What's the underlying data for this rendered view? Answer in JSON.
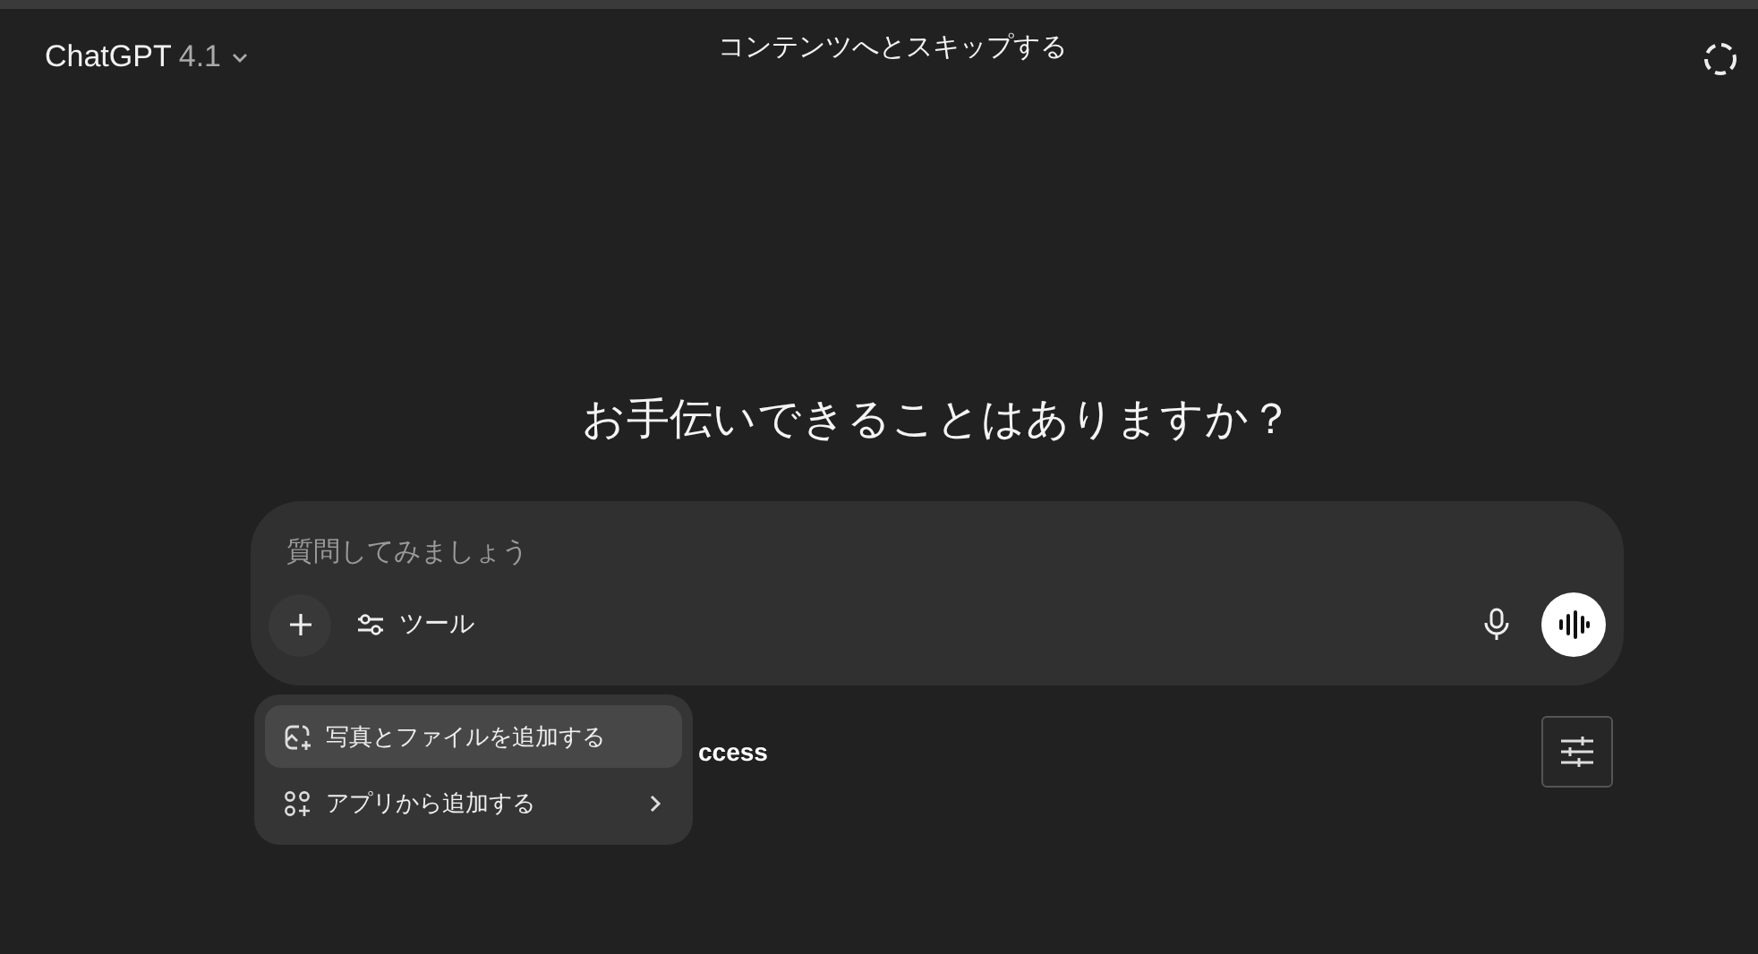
{
  "header": {
    "model_name": "ChatGPT",
    "model_version": "4.1",
    "skip_link": "コンテンツへとスキップする"
  },
  "heading": "お手伝いできることはありますか？",
  "composer": {
    "placeholder": "質問してみましょう",
    "tools_label": "ツール"
  },
  "partial_text": "ccess",
  "attach_menu": {
    "items": [
      {
        "kind": "action",
        "label": "写真とファイルを追加する",
        "selected": true
      },
      {
        "kind": "submenu",
        "label": "アプリから追加する",
        "selected": false
      }
    ]
  }
}
